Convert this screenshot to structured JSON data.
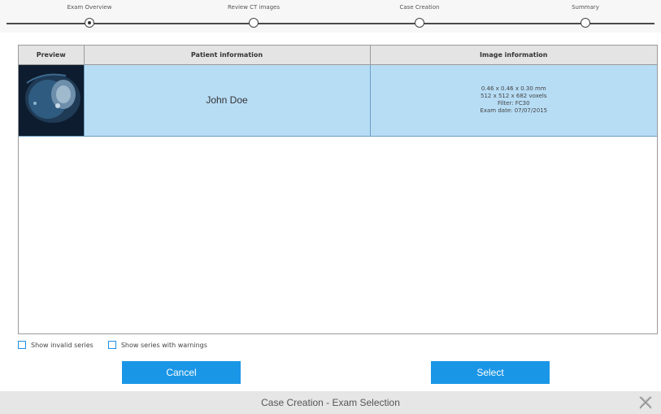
{
  "stepper": {
    "steps": [
      {
        "label": "Exam Overview",
        "active": true
      },
      {
        "label": "Review CT images",
        "active": false
      },
      {
        "label": "Case Creation",
        "active": false
      },
      {
        "label": "Summary",
        "active": false
      }
    ]
  },
  "table": {
    "headers": {
      "preview": "Preview",
      "patient": "Patient information",
      "image": "Image information"
    },
    "rows": [
      {
        "patient_name": "John Doe",
        "image_info": [
          "0.46 x 0.46 x 0.30 mm",
          "512 x 512 x 682 voxels",
          "Filter: FC30",
          "Exam date: 07/07/2015"
        ]
      }
    ]
  },
  "options": {
    "invalid_series": "Show invalid series",
    "warnings_series": "Show series with warnings"
  },
  "buttons": {
    "cancel": "Cancel",
    "select": "Select"
  },
  "footer": {
    "title": "Case Creation - Exam Selection",
    "close_icon": "close-x-icon"
  },
  "colors": {
    "accent": "#1a96e6",
    "row_selected": "#b7ddf5"
  }
}
